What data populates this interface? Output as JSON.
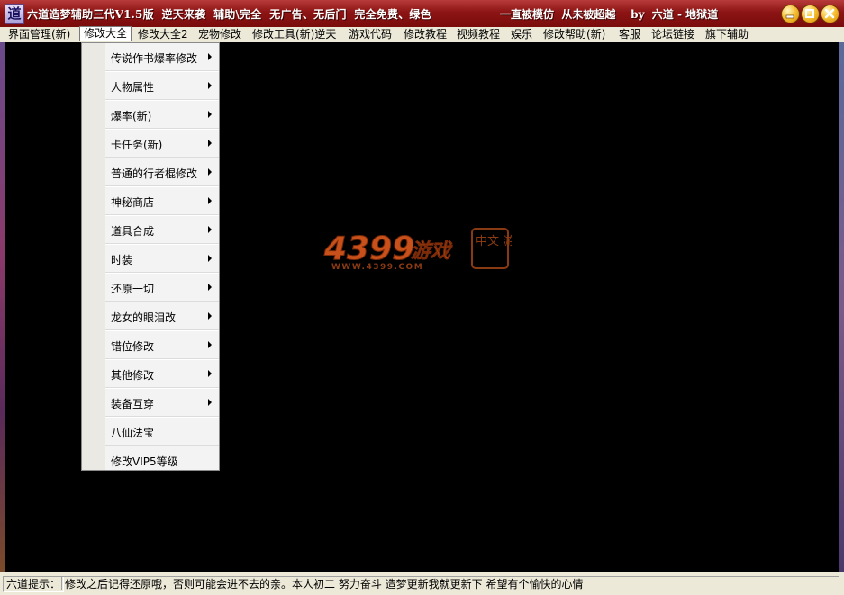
{
  "window": {
    "icon_glyph": "道",
    "title": "六道造梦辅助三代V1.5版  逆天来袭  辅助\\完全  无广告、无后门  完全免费、绿色",
    "title_right": "一直被模仿  从未被超越    by  六道 - 地狱道",
    "buttons": [
      "minimize-icon",
      "maximize-icon",
      "close-icon"
    ]
  },
  "menubar": {
    "items": [
      {
        "label": "界面管理(新)"
      },
      {
        "label": "修改大全"
      },
      {
        "label": "修改大全2"
      },
      {
        "label": "宠物修改"
      },
      {
        "label": "修改工具(新)逆天"
      },
      {
        "label": "游戏代码"
      },
      {
        "label": "修改教程"
      },
      {
        "label": "视频教程"
      },
      {
        "label": "娱乐"
      },
      {
        "label": "修改帮助(新)"
      },
      {
        "label": "客服"
      },
      {
        "label": "论坛链接"
      },
      {
        "label": "旗下辅助"
      }
    ],
    "active": "修改大全"
  },
  "dropdown": {
    "items": [
      {
        "label": "传说作书爆率修改",
        "submenu": true
      },
      {
        "label": "人物属性",
        "submenu": true
      },
      {
        "label": "爆率(新)",
        "submenu": true
      },
      {
        "label": "卡任务(新)",
        "submenu": true
      },
      {
        "label": "普通的行者棍修改",
        "submenu": true
      },
      {
        "label": "神秘商店",
        "submenu": true
      },
      {
        "label": "道具合成",
        "submenu": true
      },
      {
        "label": "时装",
        "submenu": true
      },
      {
        "label": "还原一切",
        "submenu": true
      },
      {
        "label": "龙女的眼泪改",
        "submenu": true
      },
      {
        "label": "错位修改",
        "submenu": true
      },
      {
        "label": "其他修改",
        "submenu": true
      },
      {
        "label": "装备互穿",
        "submenu": true
      },
      {
        "label": "八仙法宝",
        "submenu": false
      },
      {
        "label": "修改VIP5等级",
        "submenu": false
      }
    ]
  },
  "watermark": {
    "brand": "4399",
    "brand_cn": "游戏",
    "url": "WWW.4399.COM",
    "seal": "中文 游戏"
  },
  "statusbar": {
    "label": "六道提示：",
    "message": "修改之后记得还原哦，否则可能会进不去的亲。本人初二  努力奋斗  造梦更新我就更新下  希望有个愉快的心情"
  },
  "colors": {
    "title_bar": "#8c1414",
    "menu_bg": "#ece9d8",
    "main_bg": "#000000",
    "logo_orange": "#c8501a"
  }
}
